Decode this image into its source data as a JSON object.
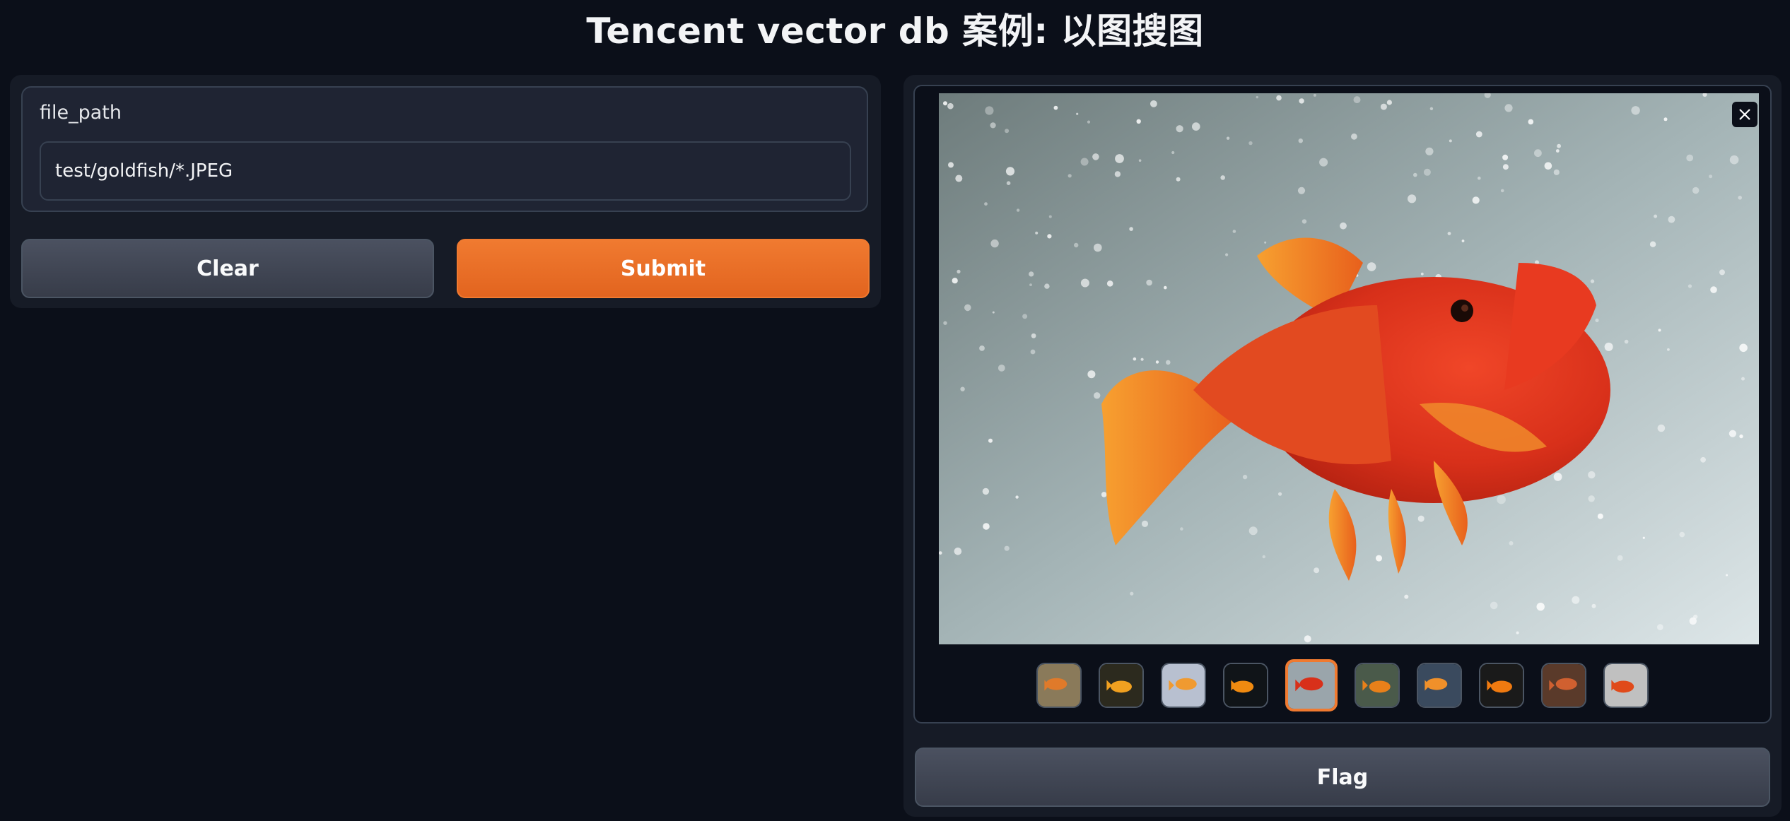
{
  "page": {
    "title": "Tencent vector db 案例: 以图搜图"
  },
  "input_panel": {
    "label": "file_path",
    "value": "test/goldfish/*.JPEG"
  },
  "buttons": {
    "clear_label": "Clear",
    "submit_label": "Submit",
    "flag_label": "Flag"
  },
  "gallery": {
    "preview_image": "goldfish-in-bubbles",
    "close_icon": "close-icon",
    "selected_index": 4,
    "thumbnails": [
      {
        "name": "thumbnail-1",
        "bg": "#8a7a5a",
        "fish": "#e07a2a"
      },
      {
        "name": "thumbnail-2",
        "bg": "#2c2a1e",
        "fish": "#f0a020"
      },
      {
        "name": "thumbnail-3",
        "bg": "#b8c0d0",
        "fish": "#f09a30"
      },
      {
        "name": "thumbnail-4",
        "bg": "#101418",
        "fish": "#f08a10"
      },
      {
        "name": "thumbnail-5",
        "bg": "#9aa5ab",
        "fish": "#d8301a"
      },
      {
        "name": "thumbnail-6",
        "bg": "#4a5a4a",
        "fish": "#e8801a"
      },
      {
        "name": "thumbnail-7",
        "bg": "#3a4a5e",
        "fish": "#f0902a"
      },
      {
        "name": "thumbnail-8",
        "bg": "#1a1a1a",
        "fish": "#f07a10"
      },
      {
        "name": "thumbnail-9",
        "bg": "#5a3a2a",
        "fish": "#d06030"
      },
      {
        "name": "thumbnail-10",
        "bg": "#c0c0c0",
        "fish": "#e04a1a"
      }
    ]
  },
  "colors": {
    "background": "#0b0f19",
    "panel": "#161b26",
    "accent": "#f07a30",
    "secondary_button": "#4b5160"
  }
}
